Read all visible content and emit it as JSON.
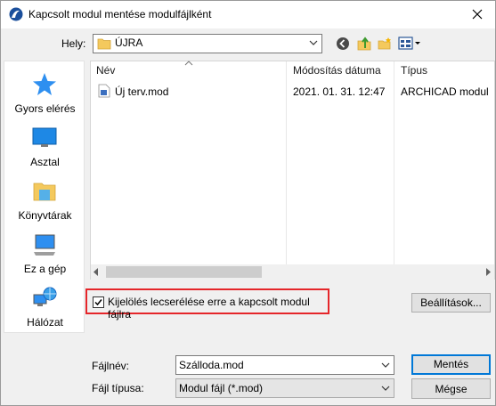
{
  "window": {
    "title": "Kapcsolt modul mentése modulfájlként"
  },
  "location": {
    "label": "Hely:",
    "value": "ÚJRA"
  },
  "sidebar": {
    "items": [
      {
        "label": "Gyors elérés",
        "icon": "star-icon"
      },
      {
        "label": "Asztal",
        "icon": "desktop-icon"
      },
      {
        "label": "Könyvtárak",
        "icon": "libraries-icon"
      },
      {
        "label": "Ez a gép",
        "icon": "computer-icon"
      },
      {
        "label": "Hálózat",
        "icon": "network-icon"
      }
    ]
  },
  "filelist": {
    "columns": [
      "Név",
      "Módosítás dátuma",
      "Típus"
    ],
    "rows": [
      {
        "name": "Új terv.mod",
        "modified": "2021. 01. 31. 12:47",
        "type": "ARCHICAD modul"
      }
    ]
  },
  "options": {
    "checkbox_label": "Kijelölés lecserélése erre a kapcsolt modul fájlra",
    "checked": true,
    "settings_button": "Beállítások..."
  },
  "filename": {
    "label": "Fájlnév:",
    "value": "Szálloda.mod"
  },
  "filetype": {
    "label": "Fájl típusa:",
    "value": "Modul fájl (*.mod)"
  },
  "buttons": {
    "save": "Mentés",
    "cancel": "Mégse"
  },
  "colors": {
    "accent": "#0078d7",
    "highlight_border": "#e5262a",
    "folder": "#f4c95d"
  }
}
